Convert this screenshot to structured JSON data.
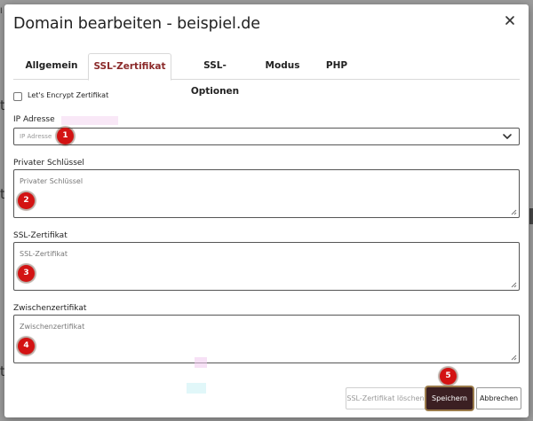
{
  "window": {
    "title": "Domain bearbeiten - beispiel.de"
  },
  "tabs": [
    {
      "label": "Allgemein",
      "active": false
    },
    {
      "label": "SSL-Zertifikat",
      "active": true
    },
    {
      "label": "SSL-Optionen",
      "active": false
    },
    {
      "label": "Modus",
      "active": false
    },
    {
      "label": "PHP",
      "active": false
    }
  ],
  "form": {
    "letsencrypt": {
      "label": "Let's Encrypt Zertifikat",
      "checked": false
    },
    "ip": {
      "label": "IP Adresse",
      "placeholder": "IP Adresse",
      "value": ""
    },
    "private_key": {
      "label": "Privater Schlüssel",
      "placeholder": "Privater Schlüssel",
      "value": ""
    },
    "ssl_cert": {
      "label": "SSL-Zertifikat",
      "placeholder": "SSL-Zertifikat",
      "value": ""
    },
    "intermediate_cert": {
      "label": "Zwischenzertifikat",
      "placeholder": "Zwischenzertifikat",
      "value": ""
    }
  },
  "buttons": {
    "delete_cert": "SSL-Zertifikat löschen",
    "save": "Speichern",
    "cancel": "Abbrechen"
  },
  "markers": [
    "1",
    "2",
    "3",
    "4",
    "5"
  ],
  "colors": {
    "active_tab": "#8b2a2a",
    "save_button": "#3b1f22",
    "marker": "#d31313",
    "overlay": "#9c9c9c"
  },
  "icons": {
    "close": "close-icon",
    "select_arrow": "chevron-down-icon",
    "resize": "resize-grip-icon"
  }
}
